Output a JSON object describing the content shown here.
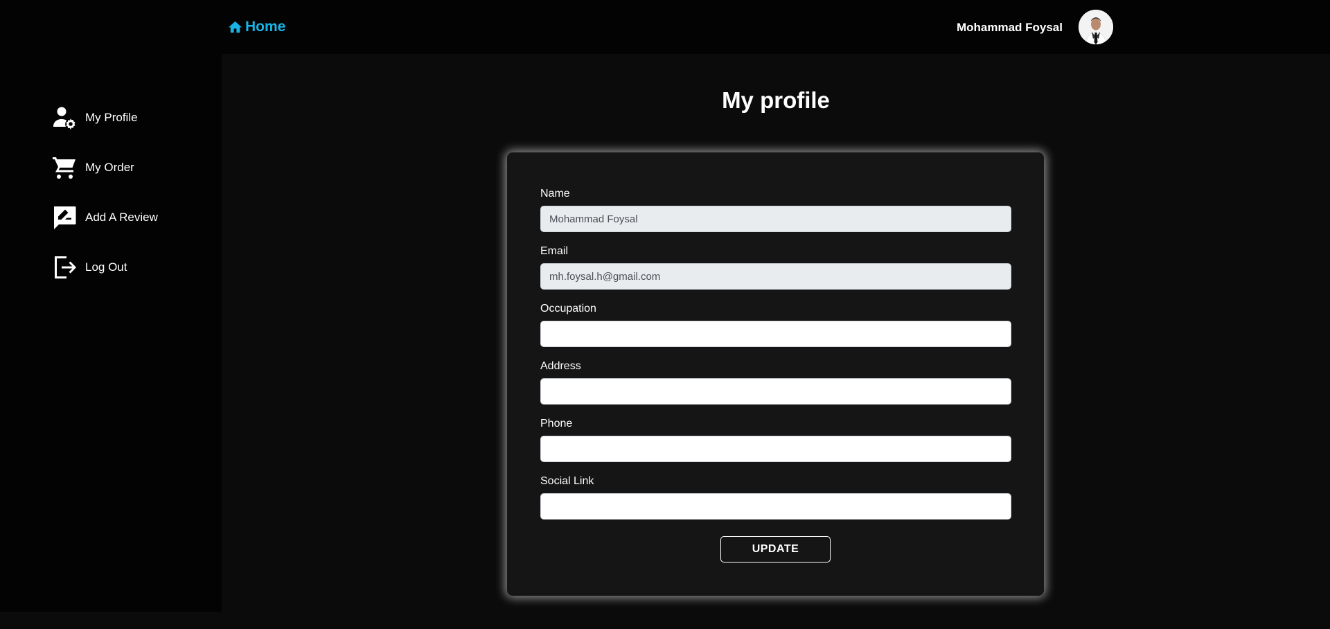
{
  "header": {
    "home_label": "Home",
    "home_icon": "home-icon",
    "user_name": "Mohammad Foysal",
    "avatar": "user-avatar"
  },
  "sidebar": {
    "items": [
      {
        "label": "My Profile",
        "icon": "user-gear-icon"
      },
      {
        "label": "My Order",
        "icon": "cart-icon"
      },
      {
        "label": "Add A Review",
        "icon": "review-icon"
      },
      {
        "label": "Log Out",
        "icon": "logout-icon"
      }
    ]
  },
  "main": {
    "title": "My profile",
    "form": {
      "name": {
        "label": "Name",
        "value": "Mohammad Foysal"
      },
      "email": {
        "label": "Email",
        "value": "mh.foysal.h@gmail.com"
      },
      "occupation": {
        "label": "Occupation",
        "value": ""
      },
      "address": {
        "label": "Address",
        "value": ""
      },
      "phone": {
        "label": "Phone",
        "value": ""
      },
      "social": {
        "label": "Social Link",
        "value": ""
      },
      "update_label": "UPDATE"
    }
  },
  "colors": {
    "accent": "#18b4e6",
    "background": "#0b0b0b",
    "card": "#151515"
  }
}
